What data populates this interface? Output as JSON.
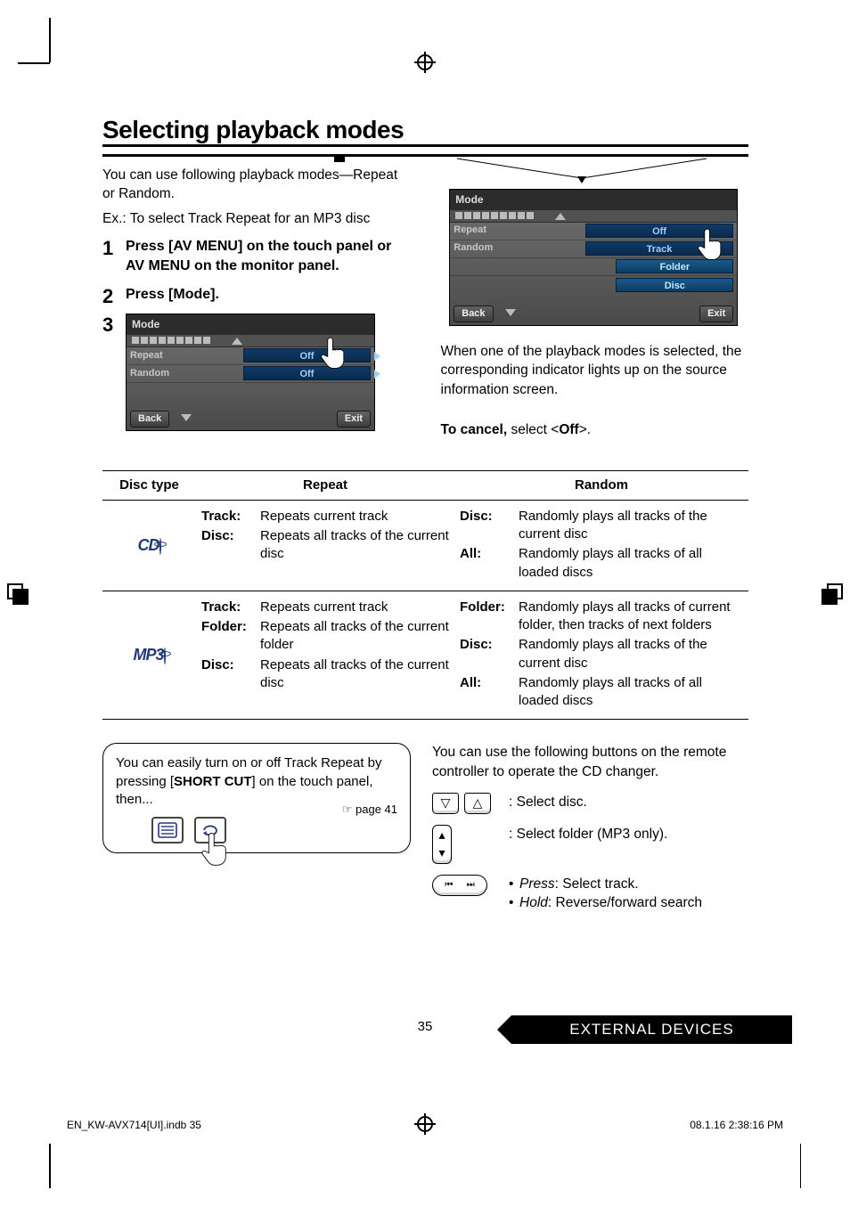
{
  "title": "Selecting playback modes",
  "intro_line1": "You can use following playback modes—Repeat or Random.",
  "intro_line2": "Ex.: To select Track Repeat for an MP3 disc",
  "steps": {
    "n1": "1",
    "s1": "Press [AV MENU] on the touch panel or AV MENU on the monitor panel.",
    "n2": "2",
    "s2": "Press [Mode].",
    "n3": "3"
  },
  "screenshot1": {
    "title": "Mode",
    "row1_label": "Repeat",
    "row1_val": "Off",
    "row2_label": "Random",
    "row2_val": "Off",
    "back": "Back",
    "exit": "Exit"
  },
  "screenshot2": {
    "title": "Mode",
    "row1_label": "Repeat",
    "row1_val": "Off",
    "row2_label": "Random",
    "row2_val": "Track",
    "row2_folder": "Folder",
    "row2_disc": "Disc",
    "back": "Back",
    "exit": "Exit",
    "close": "×"
  },
  "right_para": "When one of the playback modes is selected, the corresponding indicator lights up on the source information screen.",
  "cancel_prefix": "To cancel,",
  "cancel_mid": " select <",
  "cancel_off": "Off",
  "cancel_suffix": ">.",
  "table": {
    "h1": "Disc type",
    "h2": "Repeat",
    "h3": "Random",
    "row1": {
      "icon": "CD",
      "repeat": [
        {
          "term": "Track:",
          "desc": "Repeats current track"
        },
        {
          "term": "Disc:",
          "desc": "Repeats all tracks of the current disc"
        }
      ],
      "random": [
        {
          "term": "Disc:",
          "desc": "Randomly plays all tracks of the current disc"
        },
        {
          "term": "All:",
          "desc": "Randomly plays all tracks of all loaded discs"
        }
      ]
    },
    "row2": {
      "icon": "MP3",
      "repeat": [
        {
          "term": "Track:",
          "desc": "Repeats current track"
        },
        {
          "term": "Folder:",
          "desc": "Repeats all tracks of the current folder"
        },
        {
          "term": "Disc:",
          "desc": "Repeats all tracks of the current disc"
        }
      ],
      "random": [
        {
          "term": "Folder:",
          "desc": "Randomly plays all tracks of current folder, then tracks of next folders"
        },
        {
          "term": "Disc:",
          "desc": "Randomly plays all tracks of the current disc"
        },
        {
          "term": "All:",
          "desc": "Randomly plays all tracks of all loaded discs"
        }
      ]
    }
  },
  "tip": {
    "line_pre": "You can easily turn on or off Track Repeat by pressing [",
    "bold": "SHORT CUT",
    "line_post": "] on the touch panel, then...",
    "pageref": "☞ page 41"
  },
  "remote": {
    "intro": "You can use the following buttons on the remote controller to operate the CD changer.",
    "r1": ":  Select disc.",
    "r2": ":  Select folder (MP3 only).",
    "r3a_term": "Press",
    "r3a_desc": ": Select track.",
    "r3b_term": "Hold",
    "r3b_desc": ": Reverse/forward search"
  },
  "footer": {
    "tab": "EXTERNAL DEVICES",
    "pagenum": "35",
    "meta_left": "EN_KW-AVX714[UI].indb   35",
    "meta_right": "08.1.16   2:38:16 PM"
  },
  "icons": {
    "list": "list-icon",
    "repeat": "repeat-icon",
    "finger": "pointer-finger-icon",
    "tri_down": "▽",
    "tri_up": "△",
    "tri_small_up": "▴",
    "tri_small_down": "▾",
    "skip_prev": "⏮",
    "skip_next": "⏭"
  }
}
